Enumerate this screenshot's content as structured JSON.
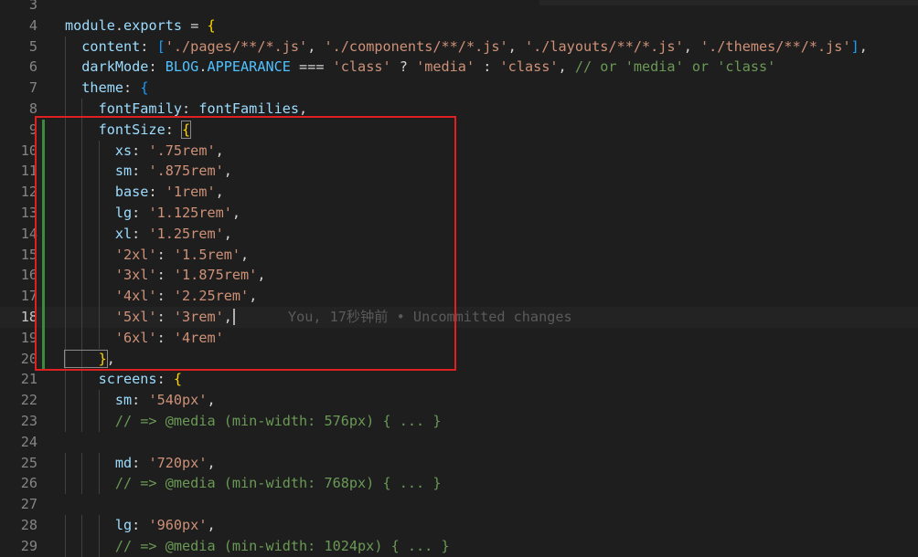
{
  "annotation": {
    "color": "#e02020"
  },
  "blame": {
    "text": "You, 17秒钟前 • Uncommitted changes"
  },
  "lines": [
    {
      "n": "3",
      "code": []
    },
    {
      "n": "4",
      "code": [
        {
          "t": "module",
          "c": "t-v"
        },
        {
          "t": ".",
          "c": "t-p"
        },
        {
          "t": "exports",
          "c": "t-v"
        },
        {
          "t": " = ",
          "c": "t-p"
        },
        {
          "t": "{",
          "c": "t-y"
        }
      ]
    },
    {
      "n": "5",
      "code": [
        {
          "t": "  content",
          "c": "t-v"
        },
        {
          "t": ": ",
          "c": "t-p"
        },
        {
          "t": "[",
          "c": "t-b"
        },
        {
          "t": "'./pages/**/*.js'",
          "c": "t-s"
        },
        {
          "t": ", ",
          "c": "t-p"
        },
        {
          "t": "'./components/**/*.js'",
          "c": "t-s"
        },
        {
          "t": ", ",
          "c": "t-p"
        },
        {
          "t": "'./layouts/**/*.js'",
          "c": "t-s"
        },
        {
          "t": ", ",
          "c": "t-p"
        },
        {
          "t": "'./themes/**/*.js'",
          "c": "t-s"
        },
        {
          "t": "]",
          "c": "t-b"
        },
        {
          "t": ",",
          "c": "t-p"
        }
      ]
    },
    {
      "n": "6",
      "code": [
        {
          "t": "  darkMode",
          "c": "t-v"
        },
        {
          "t": ": ",
          "c": "t-p"
        },
        {
          "t": "BLOG",
          "c": "t-o"
        },
        {
          "t": ".",
          "c": "t-p"
        },
        {
          "t": "APPEARANCE",
          "c": "t-o"
        },
        {
          "t": " === ",
          "c": "t-p"
        },
        {
          "t": "'class'",
          "c": "t-s"
        },
        {
          "t": " ? ",
          "c": "t-p"
        },
        {
          "t": "'media'",
          "c": "t-s"
        },
        {
          "t": " : ",
          "c": "t-p"
        },
        {
          "t": "'class'",
          "c": "t-s"
        },
        {
          "t": ", ",
          "c": "t-p"
        },
        {
          "t": "// or 'media' or 'class'",
          "c": "t-c"
        }
      ]
    },
    {
      "n": "7",
      "code": [
        {
          "t": "  theme",
          "c": "t-v"
        },
        {
          "t": ": ",
          "c": "t-p"
        },
        {
          "t": "{",
          "c": "t-b"
        }
      ]
    },
    {
      "n": "8",
      "code": [
        {
          "t": "    fontFamily",
          "c": "t-v"
        },
        {
          "t": ": ",
          "c": "t-p"
        },
        {
          "t": "fontFamilies",
          "c": "t-v"
        },
        {
          "t": ",",
          "c": "t-p"
        }
      ]
    },
    {
      "n": "9",
      "code": [
        {
          "t": "    fontSize",
          "c": "t-v"
        },
        {
          "t": ": ",
          "c": "t-p"
        },
        {
          "t": "{",
          "c": "t-y bracket-hl"
        }
      ],
      "git": true
    },
    {
      "n": "10",
      "code": [
        {
          "t": "      xs",
          "c": "t-v"
        },
        {
          "t": ": ",
          "c": "t-p"
        },
        {
          "t": "'.75rem'",
          "c": "t-s"
        },
        {
          "t": ",",
          "c": "t-p"
        }
      ],
      "git": true
    },
    {
      "n": "11",
      "code": [
        {
          "t": "      sm",
          "c": "t-v"
        },
        {
          "t": ": ",
          "c": "t-p"
        },
        {
          "t": "'.875rem'",
          "c": "t-s"
        },
        {
          "t": ",",
          "c": "t-p"
        }
      ],
      "git": true
    },
    {
      "n": "12",
      "code": [
        {
          "t": "      base",
          "c": "t-v"
        },
        {
          "t": ": ",
          "c": "t-p"
        },
        {
          "t": "'1rem'",
          "c": "t-s"
        },
        {
          "t": ",",
          "c": "t-p"
        }
      ],
      "git": true
    },
    {
      "n": "13",
      "code": [
        {
          "t": "      lg",
          "c": "t-v"
        },
        {
          "t": ": ",
          "c": "t-p"
        },
        {
          "t": "'1.125rem'",
          "c": "t-s"
        },
        {
          "t": ",",
          "c": "t-p"
        }
      ],
      "git": true
    },
    {
      "n": "14",
      "code": [
        {
          "t": "      xl",
          "c": "t-v"
        },
        {
          "t": ": ",
          "c": "t-p"
        },
        {
          "t": "'1.25rem'",
          "c": "t-s"
        },
        {
          "t": ",",
          "c": "t-p"
        }
      ],
      "git": true
    },
    {
      "n": "15",
      "code": [
        {
          "t": "      '2xl'",
          "c": "t-s"
        },
        {
          "t": ": ",
          "c": "t-p"
        },
        {
          "t": "'1.5rem'",
          "c": "t-s"
        },
        {
          "t": ",",
          "c": "t-p"
        }
      ],
      "git": true
    },
    {
      "n": "16",
      "code": [
        {
          "t": "      '3xl'",
          "c": "t-s"
        },
        {
          "t": ": ",
          "c": "t-p"
        },
        {
          "t": "'1.875rem'",
          "c": "t-s"
        },
        {
          "t": ",",
          "c": "t-p"
        }
      ],
      "git": true
    },
    {
      "n": "17",
      "code": [
        {
          "t": "      '4xl'",
          "c": "t-s"
        },
        {
          "t": ": ",
          "c": "t-p"
        },
        {
          "t": "'2.25rem'",
          "c": "t-s"
        },
        {
          "t": ",",
          "c": "t-p"
        }
      ],
      "git": true
    },
    {
      "n": "18",
      "code": [
        {
          "t": "      '5xl'",
          "c": "t-s"
        },
        {
          "t": ": ",
          "c": "t-p"
        },
        {
          "t": "'3rem'",
          "c": "t-s"
        },
        {
          "t": ",",
          "c": "t-p"
        }
      ],
      "git": true,
      "current": true
    },
    {
      "n": "19",
      "code": [
        {
          "t": "      '6xl'",
          "c": "t-s"
        },
        {
          "t": ": ",
          "c": "t-p"
        },
        {
          "t": "'4rem'",
          "c": "t-s"
        }
      ],
      "git": true
    },
    {
      "n": "20",
      "code": [
        {
          "t": "    }",
          "c": "t-y bracket-hl"
        },
        {
          "t": ",",
          "c": "t-p"
        }
      ],
      "git": true
    },
    {
      "n": "21",
      "code": [
        {
          "t": "    screens",
          "c": "t-v"
        },
        {
          "t": ": ",
          "c": "t-p"
        },
        {
          "t": "{",
          "c": "t-y"
        }
      ]
    },
    {
      "n": "22",
      "code": [
        {
          "t": "      sm",
          "c": "t-v"
        },
        {
          "t": ": ",
          "c": "t-p"
        },
        {
          "t": "'540px'",
          "c": "t-s"
        },
        {
          "t": ",",
          "c": "t-p"
        }
      ]
    },
    {
      "n": "23",
      "code": [
        {
          "t": "      // => @media (min-width: 576px) { ... }",
          "c": "t-c"
        }
      ]
    },
    {
      "n": "24",
      "code": []
    },
    {
      "n": "25",
      "code": [
        {
          "t": "      md",
          "c": "t-v"
        },
        {
          "t": ": ",
          "c": "t-p"
        },
        {
          "t": "'720px'",
          "c": "t-s"
        },
        {
          "t": ",",
          "c": "t-p"
        }
      ]
    },
    {
      "n": "26",
      "code": [
        {
          "t": "      // => @media (min-width: 768px) { ... }",
          "c": "t-c"
        }
      ]
    },
    {
      "n": "27",
      "code": []
    },
    {
      "n": "28",
      "code": [
        {
          "t": "      lg",
          "c": "t-v"
        },
        {
          "t": ": ",
          "c": "t-p"
        },
        {
          "t": "'960px'",
          "c": "t-s"
        },
        {
          "t": ",",
          "c": "t-p"
        }
      ]
    },
    {
      "n": "29",
      "code": [
        {
          "t": "      // => @media (min-width: 1024px) { ... }",
          "c": "t-c"
        }
      ]
    }
  ]
}
